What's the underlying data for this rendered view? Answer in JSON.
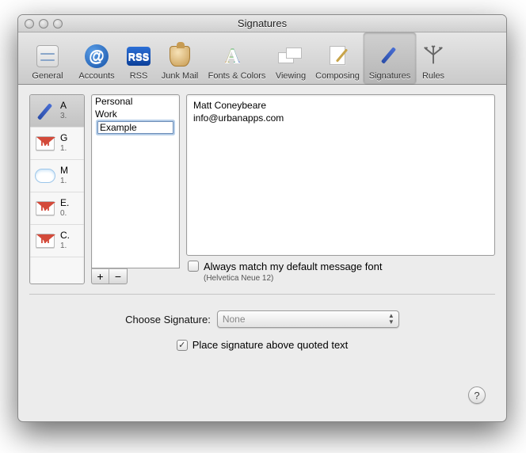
{
  "window": {
    "title": "Signatures"
  },
  "toolbar": {
    "items": [
      {
        "label": "General"
      },
      {
        "label": "Accounts"
      },
      {
        "label": "RSS"
      },
      {
        "label": "Junk Mail"
      },
      {
        "label": "Fonts & Colors"
      },
      {
        "label": "Viewing"
      },
      {
        "label": "Composing"
      },
      {
        "label": "Signatures"
      },
      {
        "label": "Rules"
      }
    ],
    "selected_index": 7
  },
  "accounts": [
    {
      "name": "A",
      "sub": "3."
    },
    {
      "name": "G",
      "sub": "1."
    },
    {
      "name": "M",
      "sub": "1."
    },
    {
      "name": "E.",
      "sub": "0."
    },
    {
      "name": "C.",
      "sub": "1."
    }
  ],
  "signatures": {
    "items": [
      "Personal",
      "Work",
      "Example"
    ],
    "editing_index": 2,
    "editing_value": "Example"
  },
  "signature_body": {
    "line1": "Matt Coneybeare",
    "line2": "info@urbanapps.com"
  },
  "match_font": {
    "checked": false,
    "label": "Always match my default message font",
    "sub": "(Helvetica Neue 12)"
  },
  "choose": {
    "label": "Choose Signature:",
    "value": "None"
  },
  "place_above": {
    "checked": true,
    "label": "Place signature above quoted text"
  },
  "buttons": {
    "add": "+",
    "remove": "−",
    "help": "?"
  }
}
